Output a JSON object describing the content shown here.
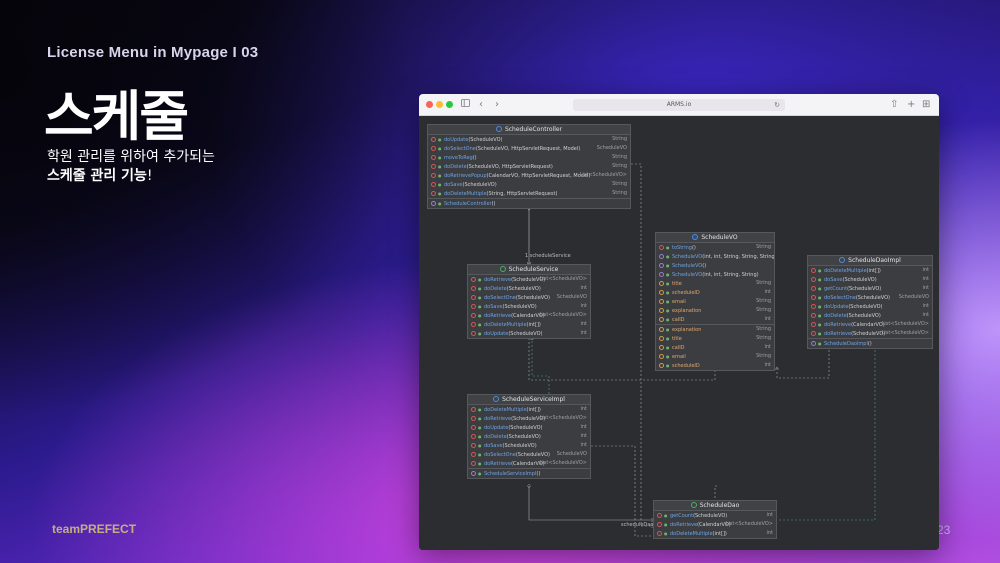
{
  "slide": {
    "subtitle": "License Menu in Mypage I 03",
    "title": "스케줄",
    "desc_line1": "학원 관리를 위하여 추가되는",
    "desc_line2_bold": "스케줄 관리 기능",
    "desc_line2_tail": "!",
    "brand": "teamPREFECT",
    "page": "23"
  },
  "browser": {
    "url": "ARMS.io",
    "controls": {
      "sidebar": "sidebar-icon",
      "back": "‹",
      "forward": "›",
      "share": "⇧",
      "new_tab": "+",
      "tabs": "⊞",
      "reload": "↻"
    }
  },
  "diagram": {
    "classes": {
      "controller": {
        "name": "ScheduleController",
        "rows": [
          {
            "n": "doUpdate",
            "p": "(ScheduleVO)",
            "t": "String",
            "k": "m"
          },
          {
            "n": "doSelectOne",
            "p": "(ScheduleVO, HttpServletRequest, Model)",
            "t": "ScheduleVO",
            "k": "m"
          },
          {
            "n": "moveToReg",
            "p": "()",
            "t": "String",
            "k": "m"
          },
          {
            "n": "doDelete",
            "p": "(ScheduleVO, HttpServletRequest)",
            "t": "String",
            "k": "m"
          },
          {
            "n": "doRetrievePopup",
            "p": "(CalendarVO, HttpServletRequest, Model)",
            "t": "List<ScheduleVO>",
            "k": "m"
          },
          {
            "n": "doSave",
            "p": "(ScheduleVO)",
            "t": "String",
            "k": "m"
          },
          {
            "n": "doDeleteMultiple",
            "p": "(String, HttpServletRequest)",
            "t": "String",
            "k": "m"
          },
          {
            "n": "ScheduleController",
            "p": "()",
            "t": "",
            "k": "c"
          }
        ]
      },
      "service": {
        "name": "ScheduleService",
        "rows": [
          {
            "n": "doRetrieve",
            "p": "(ScheduleVO)",
            "t": "List<ScheduleVO>",
            "k": "m"
          },
          {
            "n": "doDelete",
            "p": "(ScheduleVO)",
            "t": "int",
            "k": "m"
          },
          {
            "n": "doSelectOne",
            "p": "(ScheduleVO)",
            "t": "ScheduleVO",
            "k": "m"
          },
          {
            "n": "doSave",
            "p": "(ScheduleVO)",
            "t": "int",
            "k": "m"
          },
          {
            "n": "doRetrieve",
            "p": "(CalendarVO)",
            "t": "List<ScheduleVO>",
            "k": "m"
          },
          {
            "n": "doDeleteMultiple",
            "p": "(int[])",
            "t": "int",
            "k": "m"
          },
          {
            "n": "doUpdate",
            "p": "(ScheduleVO)",
            "t": "int",
            "k": "m"
          }
        ]
      },
      "vo": {
        "name": "ScheduleVO",
        "rows": [
          {
            "n": "toString",
            "p": "()",
            "t": "String",
            "k": "m"
          },
          {
            "n": "ScheduleVO",
            "p": "(int, int, String, String, String)",
            "t": "",
            "k": "c"
          },
          {
            "n": "ScheduleVO",
            "p": "()",
            "t": "",
            "k": "c"
          },
          {
            "n": "ScheduleVO",
            "p": "(int, int, String, String)",
            "t": "",
            "k": "c"
          },
          {
            "n": "title",
            "p": "",
            "t": "String",
            "k": "f"
          },
          {
            "n": "scheduleID",
            "p": "",
            "t": "int",
            "k": "f"
          },
          {
            "n": "email",
            "p": "",
            "t": "String",
            "k": "f"
          },
          {
            "n": "explanation",
            "p": "",
            "t": "String",
            "k": "f"
          },
          {
            "n": "calID",
            "p": "",
            "t": "int",
            "k": "f"
          },
          {
            "n": "explanation",
            "p": "",
            "t": "String",
            "k": "f"
          },
          {
            "n": "title",
            "p": "",
            "t": "String",
            "k": "f"
          },
          {
            "n": "calID",
            "p": "",
            "t": "int",
            "k": "f"
          },
          {
            "n": "email",
            "p": "",
            "t": "String",
            "k": "f"
          },
          {
            "n": "scheduleID",
            "p": "",
            "t": "int",
            "k": "f"
          }
        ]
      },
      "daoimpl": {
        "name": "ScheduleDaoImpl",
        "rows": [
          {
            "n": "doDeleteMultiple",
            "p": "(int[])",
            "t": "int",
            "k": "m"
          },
          {
            "n": "doSave",
            "p": "(ScheduleVO)",
            "t": "int",
            "k": "m"
          },
          {
            "n": "getCount",
            "p": "(ScheduleVO)",
            "t": "int",
            "k": "m"
          },
          {
            "n": "doSelectOne",
            "p": "(ScheduleVO)",
            "t": "ScheduleVO",
            "k": "m"
          },
          {
            "n": "doUpdate",
            "p": "(ScheduleVO)",
            "t": "int",
            "k": "m"
          },
          {
            "n": "doDelete",
            "p": "(ScheduleVO)",
            "t": "int",
            "k": "m"
          },
          {
            "n": "doRetrieve",
            "p": "(CalendarVO)",
            "t": "List<ScheduleVO>",
            "k": "m"
          },
          {
            "n": "doRetrieve",
            "p": "(ScheduleVO)",
            "t": "List<ScheduleVO>",
            "k": "m"
          },
          {
            "n": "ScheduleDaoImpl",
            "p": "()",
            "t": "",
            "k": "c"
          }
        ]
      },
      "serviceimpl": {
        "name": "ScheduleServiceImpl",
        "rows": [
          {
            "n": "doDeleteMultiple",
            "p": "(int[])",
            "t": "int",
            "k": "m"
          },
          {
            "n": "doRetrieve",
            "p": "(ScheduleVO)",
            "t": "List<ScheduleVO>",
            "k": "m"
          },
          {
            "n": "doUpdate",
            "p": "(ScheduleVO)",
            "t": "int",
            "k": "m"
          },
          {
            "n": "doDelete",
            "p": "(ScheduleVO)",
            "t": "int",
            "k": "m"
          },
          {
            "n": "doSave",
            "p": "(ScheduleVO)",
            "t": "int",
            "k": "m"
          },
          {
            "n": "doSelectOne",
            "p": "(ScheduleVO)",
            "t": "ScheduleVO",
            "k": "m"
          },
          {
            "n": "doRetrieve",
            "p": "(CalendarVO)",
            "t": "List<ScheduleVO>",
            "k": "m"
          },
          {
            "n": "ScheduleServiceImpl",
            "p": "()",
            "t": "",
            "k": "c"
          }
        ]
      },
      "dao": {
        "name": "ScheduleDao",
        "rows": [
          {
            "n": "getCount",
            "p": "(ScheduleVO)",
            "t": "int",
            "k": "m"
          },
          {
            "n": "doRetrieve",
            "p": "(CalendarVO)",
            "t": "List<ScheduleVO>",
            "k": "m"
          },
          {
            "n": "doDeleteMultiple",
            "p": "(int[])",
            "t": "int",
            "k": "m"
          }
        ]
      }
    },
    "labels": {
      "service_link": "1 scheduleService",
      "dao_link": "scheduleDao"
    }
  }
}
